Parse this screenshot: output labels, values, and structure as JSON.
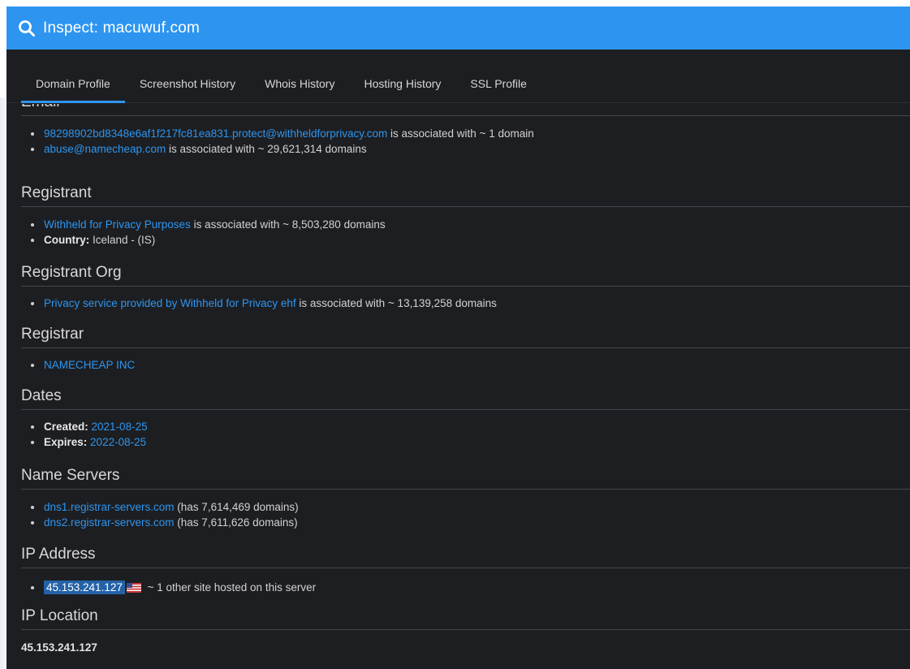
{
  "header": {
    "title": "Inspect: macuwuf.com"
  },
  "tabs": [
    {
      "label": "Domain Profile"
    },
    {
      "label": "Screenshot History"
    },
    {
      "label": "Whois History"
    },
    {
      "label": "Hosting History"
    },
    {
      "label": "SSL Profile"
    }
  ],
  "email": {
    "heading": "Email",
    "items": [
      {
        "address": "98298902bd8348e6af1f217fc81ea831.protect@withheldforprivacy.com",
        "suffix": " is associated with ~ 1 domain"
      },
      {
        "address": "abuse@namecheap.com",
        "suffix": " is associated with ~ 29,621,314 domains"
      }
    ]
  },
  "registrant": {
    "heading": "Registrant",
    "name_link": "Withheld for Privacy Purposes",
    "name_suffix": " is associated with ~ 8,503,280 domains",
    "country_label": "Country:",
    "country_value": " Iceland - (IS)"
  },
  "registrant_org": {
    "heading": "Registrant Org",
    "link": "Privacy service provided by Withheld for Privacy ehf",
    "suffix": " is associated with ~ 13,139,258 domains"
  },
  "registrar": {
    "heading": "Registrar",
    "link": "NAMECHEAP INC"
  },
  "dates": {
    "heading": "Dates",
    "created_label": "Created:",
    "created_value": "2021-08-25",
    "expires_label": "Expires:",
    "expires_value": "2022-08-25"
  },
  "name_servers": {
    "heading": "Name Servers",
    "items": [
      {
        "host": "dns1.registrar-servers.com",
        "suffix": " (has 7,614,469 domains)"
      },
      {
        "host": "dns2.registrar-servers.com",
        "suffix": " (has 7,611,626 domains)"
      }
    ]
  },
  "ip_address": {
    "heading": "IP Address",
    "ip": "45.153.241.127",
    "flag_icon": "us-flag-icon",
    "suffix": " ~ 1 other site hosted on this server"
  },
  "ip_location": {
    "heading": "IP Location",
    "value": "45.153.241.127"
  },
  "colors": {
    "accent": "#2d95f0",
    "background": "#1d1e21"
  }
}
